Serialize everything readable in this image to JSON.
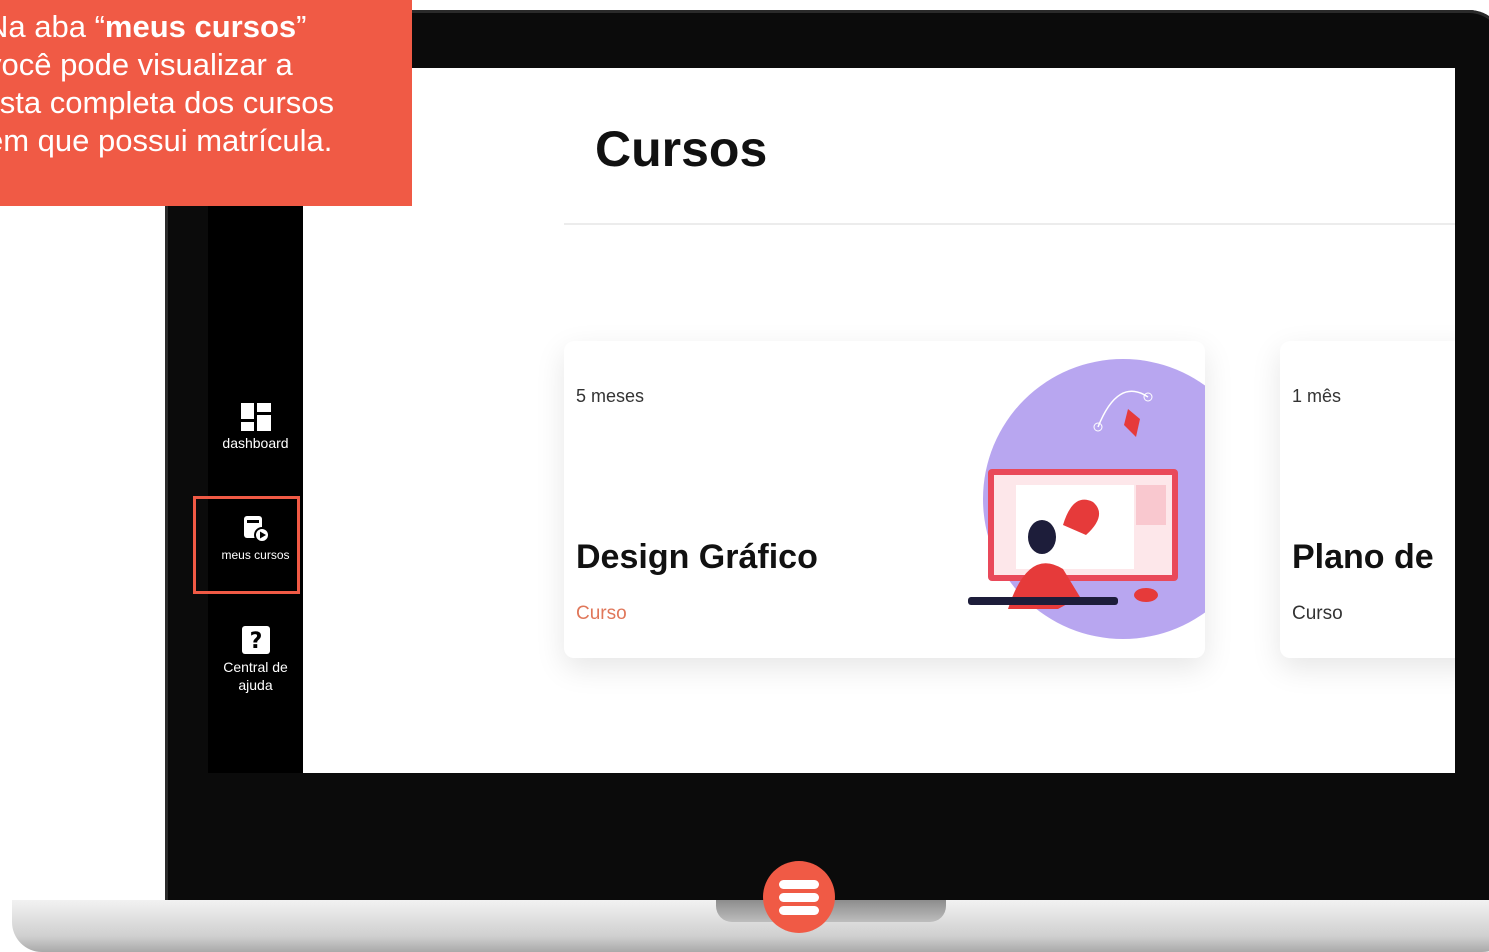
{
  "callout": {
    "line1_prefix": "Na aba “",
    "line1_bold": "meus cursos",
    "line1_suffix": "”",
    "line2": "você pode visualizar a",
    "line3": "lista completa dos cursos",
    "line4": "em que possui matrícula."
  },
  "sidebar": {
    "items": [
      {
        "label": "dashboard",
        "icon": "dashboard-icon"
      },
      {
        "label": "meus cursos",
        "icon": "course-play-icon",
        "highlighted": true
      },
      {
        "label": "Central de ajuda",
        "icon": "help-icon"
      }
    ]
  },
  "page": {
    "title": "Cursos"
  },
  "courses": [
    {
      "duration": "5 meses",
      "title": "Design Gráfico",
      "type": "Curso",
      "image": "graphic-design-illustration"
    },
    {
      "duration": "1 mês",
      "title": "Plano de",
      "type": "Curso"
    }
  ],
  "colors": {
    "accent": "#f05a45",
    "course_type_accent": "#e0775a",
    "illustration_bg": "#b8a6f0"
  }
}
